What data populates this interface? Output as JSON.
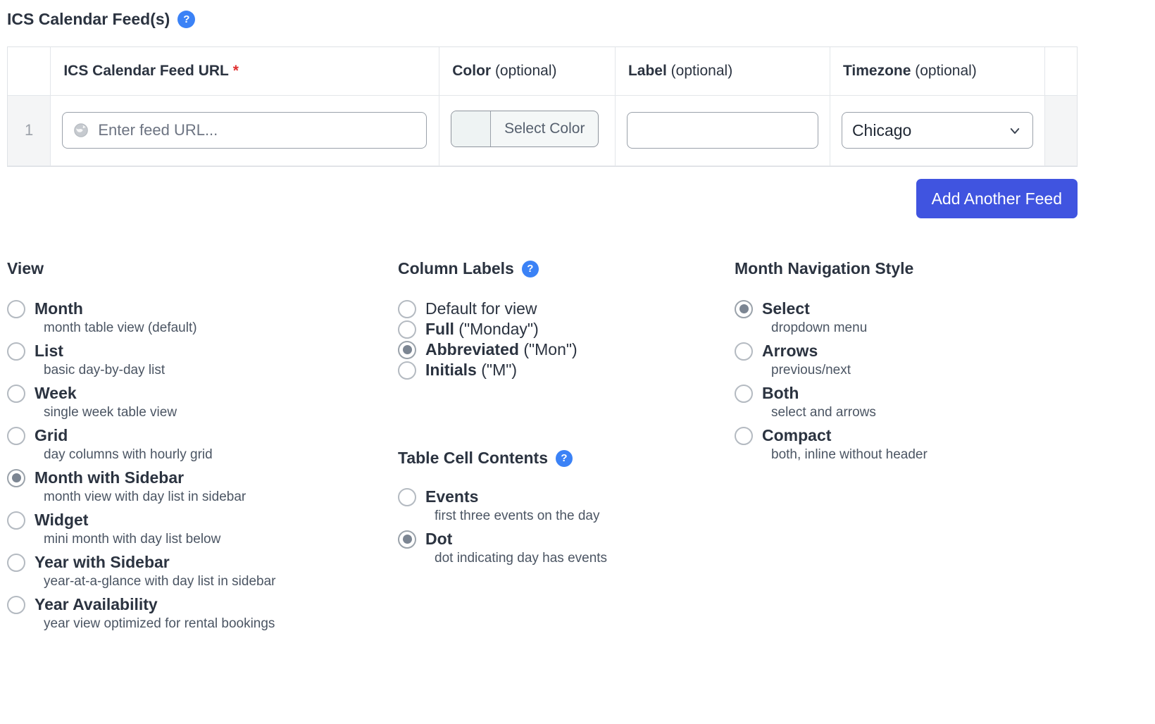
{
  "feeds_section": {
    "title": "ICS Calendar Feed(s)",
    "help_icon": "help-icon",
    "columns": {
      "index": "",
      "url_bold": "ICS Calendar Feed URL",
      "url_required": "*",
      "color_bold": "Color",
      "color_rest": "(optional)",
      "label_bold": "Label",
      "label_rest": "(optional)",
      "timezone_bold": "Timezone",
      "timezone_rest": "(optional)",
      "actions": ""
    },
    "row": {
      "index": "1",
      "url_value": "",
      "url_placeholder": "Enter feed URL...",
      "url_icon": "globe-icon",
      "color_button_label": "Select Color",
      "color_swatch_value": "",
      "label_value": "",
      "label_placeholder": "",
      "timezone_value": "Chicago",
      "timezone_chevron": "chevron-down-icon"
    },
    "add_button_label": "Add Another Feed",
    "add_button_color": "#4054e0"
  },
  "view_group": {
    "title": "View",
    "options": [
      {
        "label": "Month",
        "desc": "month table view (default)",
        "selected": false
      },
      {
        "label": "List",
        "desc": "basic day-by-day list",
        "selected": false
      },
      {
        "label": "Week",
        "desc": "single week table view",
        "selected": false
      },
      {
        "label": "Grid",
        "desc": "day columns with hourly grid",
        "selected": false
      },
      {
        "label": "Month with Sidebar",
        "desc": "month view with day list in sidebar",
        "selected": true
      },
      {
        "label": "Widget",
        "desc": "mini month with day list below",
        "selected": false
      },
      {
        "label": "Year with Sidebar",
        "desc": "year-at-a-glance with day list in sidebar",
        "selected": false
      },
      {
        "label": "Year Availability",
        "desc": "year view optimized for rental bookings",
        "selected": false
      }
    ]
  },
  "column_labels_group": {
    "title": "Column Labels",
    "help_icon": "help-icon",
    "options": [
      {
        "label": "Default for view",
        "suffix": "",
        "bold": false,
        "desc": "",
        "selected": false
      },
      {
        "label": "Full",
        "suffix": "(\"Monday\")",
        "bold": true,
        "desc": "",
        "selected": false
      },
      {
        "label": "Abbreviated",
        "suffix": "(\"Mon\")",
        "bold": true,
        "desc": "",
        "selected": true
      },
      {
        "label": "Initials",
        "suffix": "(\"M\")",
        "bold": true,
        "desc": "",
        "selected": false
      }
    ]
  },
  "table_cell_group": {
    "title": "Table Cell Contents",
    "help_icon": "help-icon",
    "options": [
      {
        "label": "Events",
        "desc": "first three events on the day",
        "selected": false
      },
      {
        "label": "Dot",
        "desc": "dot indicating day has events",
        "selected": true
      }
    ]
  },
  "month_nav_group": {
    "title": "Month Navigation Style",
    "options": [
      {
        "label": "Select",
        "desc": "dropdown menu",
        "selected": true
      },
      {
        "label": "Arrows",
        "desc": "previous/next",
        "selected": false
      },
      {
        "label": "Both",
        "desc": "select and arrows",
        "selected": false
      },
      {
        "label": "Compact",
        "desc": "both, inline without header",
        "selected": false
      }
    ]
  }
}
